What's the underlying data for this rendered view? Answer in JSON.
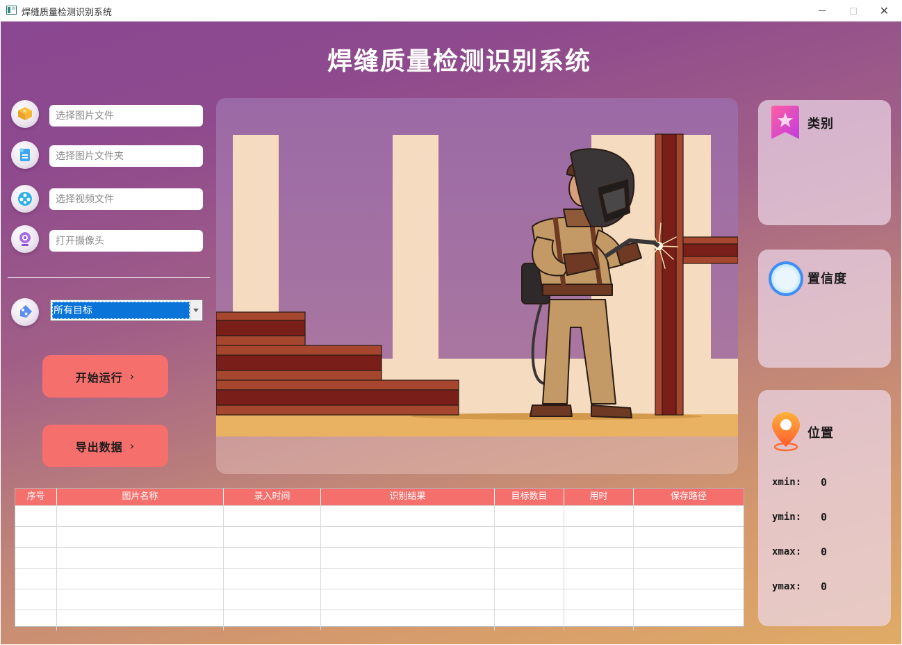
{
  "window": {
    "title": "焊缝质量检测识别系统",
    "controls": {
      "minimize": "—",
      "maximize": "☐",
      "close": "✕"
    }
  },
  "header": {
    "title": "焊缝质量检测识别系统"
  },
  "inputs": {
    "image_file": {
      "placeholder": "选择图片文件",
      "icon": "image-file-icon"
    },
    "image_folder": {
      "placeholder": "选择图片文件夹",
      "icon": "folder-icon"
    },
    "video_file": {
      "placeholder": "选择视频文件",
      "icon": "video-icon"
    },
    "camera": {
      "placeholder": "打开摄像头",
      "icon": "camera-icon"
    }
  },
  "target_select": {
    "selected": "所有目标",
    "icon": "tag-icon"
  },
  "buttons": {
    "start": {
      "label": "开始运行",
      "chevron": "›"
    },
    "export": {
      "label": "导出数据",
      "chevron": "›"
    }
  },
  "cards": {
    "category": {
      "title": "类别",
      "icon": "bookmark-star-icon",
      "value": ""
    },
    "confidence": {
      "title": "置信度",
      "icon": "ring-icon",
      "value": ""
    },
    "position": {
      "title": "位置",
      "icon": "location-pin-icon",
      "coords": [
        {
          "label": "xmin:",
          "value": "0"
        },
        {
          "label": "ymin:",
          "value": "0"
        },
        {
          "label": "xmax:",
          "value": "0"
        },
        {
          "label": "ymax:",
          "value": "0"
        }
      ]
    }
  },
  "table": {
    "columns": [
      "序号",
      "图片名称",
      "录入时间",
      "识别结果",
      "目标数目",
      "用时",
      "保存路径"
    ],
    "rows": [
      [
        "",
        "",
        "",
        "",
        "",
        "",
        ""
      ],
      [
        "",
        "",
        "",
        "",
        "",
        "",
        ""
      ],
      [
        "",
        "",
        "",
        "",
        "",
        "",
        ""
      ],
      [
        "",
        "",
        "",
        "",
        "",
        "",
        ""
      ],
      [
        "",
        "",
        "",
        "",
        "",
        "",
        ""
      ],
      [
        "",
        "",
        "",
        "",
        "",
        "",
        ""
      ]
    ]
  },
  "colors": {
    "accent_button": "#f56f6c",
    "table_header": "#f56f6c",
    "select_highlight": "#0a74d8",
    "gradient_top": "#8a4892",
    "gradient_bottom": "#e0ab66"
  }
}
